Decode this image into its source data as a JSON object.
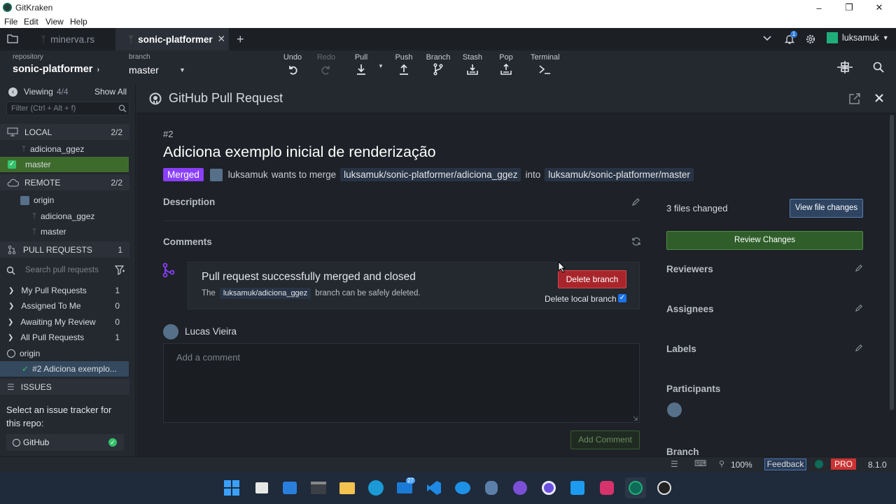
{
  "window": {
    "title": "GitKraken"
  },
  "menu": [
    "File",
    "Edit",
    "View",
    "Help"
  ],
  "tabs": [
    {
      "label": "minerva.rs",
      "active": false
    },
    {
      "label": "sonic-platformer",
      "active": true
    }
  ],
  "account": {
    "user": "luksamuk",
    "notification_count": "1"
  },
  "repo": {
    "label": "repository",
    "name": "sonic-platformer"
  },
  "branch": {
    "label": "branch",
    "name": "master"
  },
  "toolbar": [
    "Undo",
    "Redo",
    "Pull",
    "Push",
    "Branch",
    "Stash",
    "Pop",
    "Terminal"
  ],
  "sidebar": {
    "viewing_label": "Viewing",
    "viewing_count": "4/4",
    "show_all": "Show All",
    "filter_placeholder": "Filter (Ctrl + Alt + f)",
    "local": {
      "label": "LOCAL",
      "count": "2/2",
      "branches": [
        "adiciona_ggez",
        "master"
      ]
    },
    "remote": {
      "label": "REMOTE",
      "count": "2/2",
      "origin": "origin",
      "branches": [
        "adiciona_ggez",
        "master"
      ]
    },
    "pull_requests": {
      "label": "PULL REQUESTS",
      "count": "1",
      "search_placeholder": "Search pull requests",
      "groups": [
        {
          "label": "My Pull Requests",
          "count": "1"
        },
        {
          "label": "Assigned To Me",
          "count": "0"
        },
        {
          "label": "Awaiting My Review",
          "count": "0"
        },
        {
          "label": "All Pull Requests",
          "count": "1"
        }
      ],
      "origin": "origin",
      "item": "#2 Adiciona exemplo..."
    },
    "issues": {
      "label": "ISSUES",
      "prompt": "Select an issue tracker for this repo:",
      "tracker": "GitHub"
    }
  },
  "pr": {
    "header_title": "GitHub Pull Request",
    "number": "#2",
    "title": "Adiciona exemplo inicial de renderização",
    "status": "Merged",
    "author": "luksamuk",
    "wants_to_merge": "wants to merge",
    "source": "luksamuk/sonic-platformer/adiciona_ggez",
    "into": "into",
    "target": "luksamuk/sonic-platformer/master",
    "description_label": "Description",
    "comments_label": "Comments",
    "merged_title": "Pull request successfully merged and closed",
    "merged_the": "The",
    "merged_branch": "luksamuk/adiciona_ggez",
    "merged_tail": "branch can be safely deleted.",
    "delete_branch": "Delete branch",
    "delete_local": "Delete local branch",
    "commenter": "Lucas Vieira",
    "comment_placeholder": "Add a comment",
    "add_comment": "Add Comment"
  },
  "right": {
    "files_changed": "3 files changed",
    "view_file_changes": "View file changes",
    "review_changes": "Review Changes",
    "reviewers": "Reviewers",
    "assignees": "Assignees",
    "labels": "Labels",
    "participants": "Participants",
    "branch": "Branch"
  },
  "status": {
    "zoom": "100%",
    "feedback": "Feedback",
    "pro": "PRO",
    "version": "8.1.0"
  },
  "taskbar": {
    "badge": "27"
  },
  "colors": {
    "merged": "#8a3ffc",
    "delete": "#a8262b",
    "review": "#2f5e2a",
    "selected_branch": "#3d6b2c",
    "pro": "#c33"
  }
}
